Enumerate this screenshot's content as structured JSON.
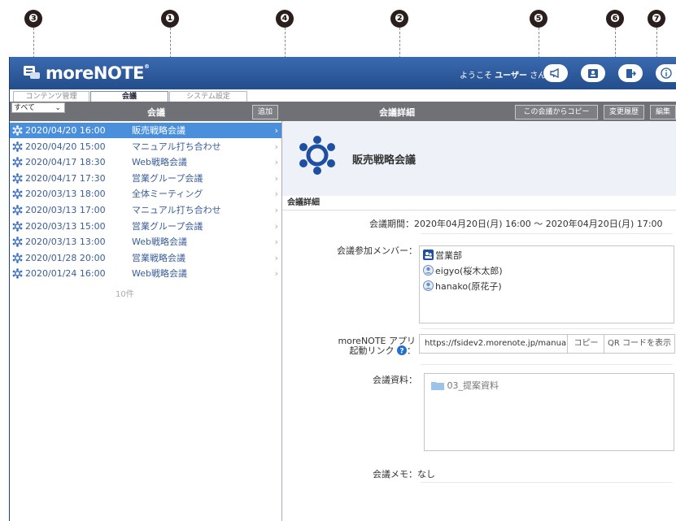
{
  "markers": [
    "❸",
    "❶",
    "❹",
    "❷",
    "❺",
    "❻",
    "❼"
  ],
  "app": {
    "logo": "moreNOTE",
    "welcome_prefix": "ようこそ",
    "user": "ユーザー",
    "welcome_suffix": "さん"
  },
  "tabs": [
    "コンテンツ管理",
    "会議",
    "システム設定"
  ],
  "toolbar": {
    "filter": "すべて",
    "list_title": "会議",
    "add": "追加",
    "detail_title": "会議詳細",
    "copy_from": "この会議からコピー",
    "history": "変更履歴",
    "edit": "編集"
  },
  "meetings": [
    {
      "date": "2020/04/20 16:00",
      "name": "販売戦略会議"
    },
    {
      "date": "2020/04/20 15:00",
      "name": "マニュアル打ち合わせ"
    },
    {
      "date": "2020/04/17 18:30",
      "name": "Web戦略会議"
    },
    {
      "date": "2020/04/17 17:30",
      "name": "営業グループ会議"
    },
    {
      "date": "2020/03/13 18:00",
      "name": "全体ミーティング"
    },
    {
      "date": "2020/03/13 17:00",
      "name": "マニュアル打ち合わせ"
    },
    {
      "date": "2020/03/13 15:00",
      "name": "営業グループ会議"
    },
    {
      "date": "2020/03/13 13:00",
      "name": "Web戦略会議"
    },
    {
      "date": "2020/01/28 20:00",
      "name": "営業戦略会議"
    },
    {
      "date": "2020/01/24 16:00",
      "name": "Web戦略会議"
    }
  ],
  "list_count": "10件",
  "detail": {
    "title": "販売戦略会議",
    "section": "会議詳細",
    "period_label": "会議期間：",
    "period": "2020年04月20日(月) 16:00 ～ 2020年04月20日(月) 17:00",
    "members_label": "会議参加メンバー：",
    "members": [
      {
        "name": "営業部",
        "icon": "group-icon"
      },
      {
        "name": "eigyo(桜木太郎)",
        "icon": "user-icon"
      },
      {
        "name": "hanako(原花子)",
        "icon": "user-icon"
      }
    ],
    "link_label_1": "moreNOTE アプリ",
    "link_label_2": "起動リンク",
    "link_colon": "：",
    "link_url": "https://fsidev2.morenote.jp/manua",
    "copy_btn": "コピー",
    "qr_btn": "QR コードを表示",
    "docs_label": "会議資料：",
    "doc": "03_提案資料",
    "memo_label": "会議メモ：",
    "memo": "なし"
  },
  "colors": {
    "header": "#2f5c9f",
    "selected": "#4a8fdc",
    "toolbar": "#6f7177"
  }
}
